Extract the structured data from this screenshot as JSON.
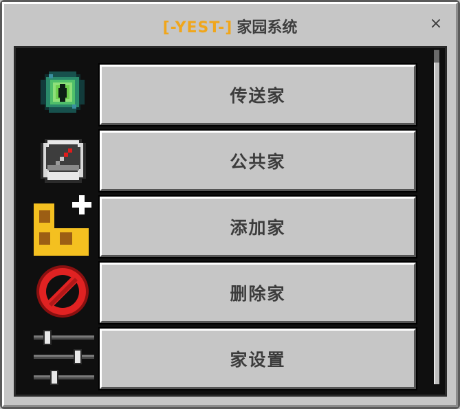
{
  "window": {
    "title_prefix": "[-YEST-]",
    "title_main": "家园系统",
    "close_label": "×"
  },
  "menu": {
    "items": [
      {
        "label": "传送家",
        "icon": "ender-eye-icon"
      },
      {
        "label": "公共家",
        "icon": "compass-icon"
      },
      {
        "label": "添加家",
        "icon": "add-home-icon"
      },
      {
        "label": "删除家",
        "icon": "delete-icon"
      },
      {
        "label": "家设置",
        "icon": "sliders-icon"
      }
    ]
  },
  "colors": {
    "accent": "#f0a61b",
    "window_bg": "#c6c6c6",
    "panel_bg": "#0f0f0f",
    "button_text": "#3c3c3c"
  }
}
